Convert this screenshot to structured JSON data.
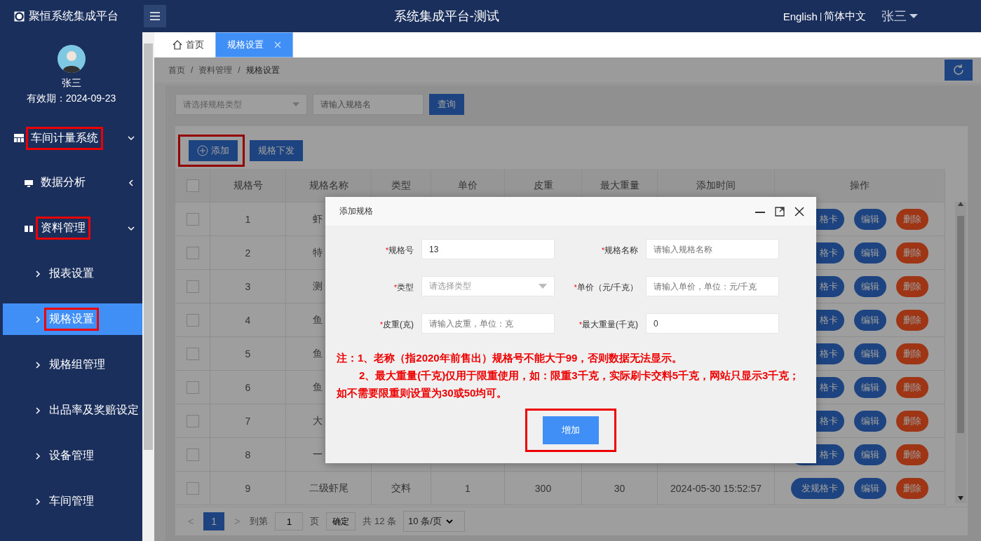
{
  "app": {
    "logo_text": "聚恒系统集成平台"
  },
  "header": {
    "title": "系统集成平台-测试",
    "languages": [
      "English",
      "简体中文"
    ],
    "lang_separator": "|",
    "user": "张三"
  },
  "sidebar": {
    "user": {
      "name": "张三",
      "validity": "有效期：2024-09-23"
    },
    "menu": [
      {
        "label": "车间计量系统",
        "expanded": true,
        "highlighted": true,
        "children": [
          {
            "label": "数据分析",
            "expanded": false,
            "highlighted": false
          },
          {
            "label": "资料管理",
            "expanded": true,
            "highlighted": true,
            "children": [
              {
                "label": "报表设置",
                "selected": false,
                "highlighted": false
              },
              {
                "label": "规格设置",
                "selected": true,
                "highlighted": true
              },
              {
                "label": "规格组管理",
                "selected": false,
                "highlighted": false
              },
              {
                "label": "出品率及奖赔设定",
                "selected": false,
                "highlighted": false
              },
              {
                "label": "设备管理",
                "selected": false,
                "highlighted": false
              },
              {
                "label": "车间管理",
                "selected": false,
                "highlighted": false
              }
            ]
          }
        ]
      }
    ]
  },
  "tabs": [
    {
      "label": "首页",
      "kind": "home",
      "selected": false,
      "closable": false
    },
    {
      "label": "规格设置",
      "kind": "page",
      "selected": true,
      "closable": true
    }
  ],
  "breadcrumb": {
    "items": [
      "首页",
      "资料管理",
      "规格设置"
    ],
    "separator": "/"
  },
  "filters": {
    "type_select": {
      "placeholder": "请选择规格类型"
    },
    "name_input": {
      "placeholder": "请输入规格名"
    },
    "search_button": "查询"
  },
  "toolbar": [
    {
      "label": "添加",
      "kind": "add",
      "highlighted": true
    },
    {
      "label": "规格下发",
      "kind": "plain",
      "highlighted": false
    }
  ],
  "table": {
    "header_checked": false,
    "columns": [
      "规格号",
      "规格名称",
      "类型",
      "单价",
      "皮重",
      "最大重量",
      "添加时间",
      "操作"
    ],
    "rows": [
      {
        "checked": false,
        "cells": [
          "1",
          "虾"
        ],
        "actions": [
          "格卡",
          "编辑",
          "删除"
        ]
      },
      {
        "checked": false,
        "cells": [
          "2",
          "特"
        ],
        "actions": [
          "格卡",
          "编辑",
          "删除"
        ]
      },
      {
        "checked": false,
        "cells": [
          "3",
          "测"
        ],
        "actions": [
          "格卡",
          "编辑",
          "删除"
        ]
      },
      {
        "checked": false,
        "cells": [
          "4",
          "鱼"
        ],
        "actions": [
          "格卡",
          "编辑",
          "删除"
        ]
      },
      {
        "checked": false,
        "cells": [
          "5",
          "鱼"
        ],
        "actions": [
          "格卡",
          "编辑",
          "删除"
        ]
      },
      {
        "checked": false,
        "cells": [
          "6",
          "鱼"
        ],
        "actions": [
          "格卡",
          "编辑",
          "删除"
        ]
      },
      {
        "checked": false,
        "cells": [
          "7",
          "大"
        ],
        "actions": [
          "格卡",
          "编辑",
          "删除"
        ]
      },
      {
        "checked": false,
        "cells": [
          "8",
          "一"
        ],
        "actions": [
          "格卡",
          "编辑",
          "删除"
        ]
      },
      {
        "checked": false,
        "cells": [
          "9",
          "二级虾尾",
          "交料",
          "1",
          "300",
          "30",
          "2024-05-30 15:52:57"
        ],
        "actions": [
          "发规格卡",
          "编辑",
          "删除"
        ]
      }
    ]
  },
  "pagination": {
    "prev": "<",
    "pages": [
      {
        "label": "1",
        "selected": true
      }
    ],
    "next": ">",
    "goto_label": "到第",
    "goto_value": "1",
    "page_unit": "页",
    "confirm": "确定",
    "total": "共 12 条",
    "page_size": "10 条/页"
  },
  "dialog": {
    "title": "添加规格",
    "required_mark": "*",
    "fields": [
      {
        "label": "规格号",
        "required": true,
        "kind": "input",
        "value": "13"
      },
      {
        "label": "规格名称",
        "required": true,
        "kind": "input",
        "placeholder": "请输入规格名称"
      },
      {
        "label": "类型",
        "required": true,
        "kind": "select",
        "placeholder": "请选择类型"
      },
      {
        "label": "单价（元/千克）",
        "required": true,
        "kind": "input",
        "placeholder": "请输入单价，单位：元/千克"
      },
      {
        "label": "皮重(克)",
        "required": true,
        "kind": "input",
        "placeholder": "请输入皮重，单位：克"
      },
      {
        "label": "最大重量(千克)",
        "required": true,
        "kind": "input",
        "value": "0"
      }
    ],
    "notes": [
      "注：1、老称（指2020年前售出）规格号不能大于99，否则数据无法显示。",
      "2、最大重量(千克)仅用于限重使用，如：限重3千克，实际刷卡交料5千克，网站只显示3千克；如不需要限重则设置为30或50均可。"
    ],
    "submit": {
      "label": "增加",
      "highlighted": true
    }
  }
}
